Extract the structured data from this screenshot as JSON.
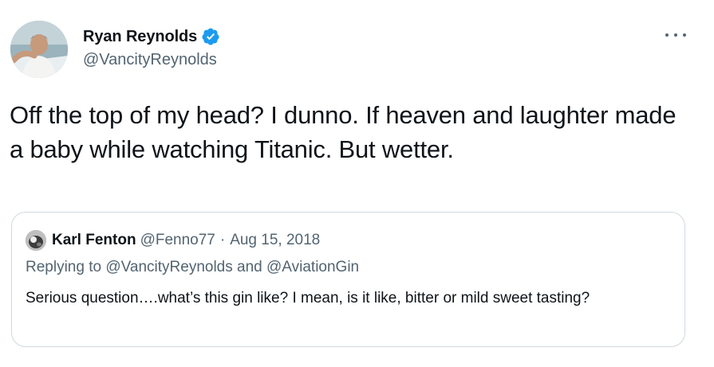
{
  "author": {
    "display_name": "Ryan Reynolds",
    "handle": "@VancityReynolds",
    "verified": true,
    "avatar_icon": "profile-photo"
  },
  "more_icon": "more-horizontal-icon",
  "tweet": {
    "text": "Off the top of my head? I dunno. If heaven and laughter made a baby while watching Titanic. But wetter."
  },
  "quoted_tweet": {
    "display_name": "Karl Fenton",
    "handle": "@Fenno77",
    "separator": "·",
    "date": "Aug 15, 2018",
    "reply_prefix": "Replying to ",
    "reply_mention_1": "@VancityReynolds",
    "reply_and": " and ",
    "reply_mention_2": "@AviationGin",
    "text": "Serious question….what’s this gin like? I mean, is it like, bitter or mild sweet tasting?"
  },
  "colors": {
    "text_primary": "#0f1419",
    "text_secondary": "#536471",
    "verified_blue": "#1d9bf0",
    "border": "#cfd9de"
  }
}
